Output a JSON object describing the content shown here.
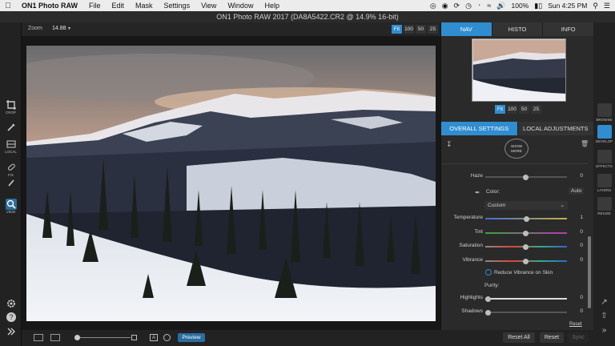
{
  "menubar": {
    "app_name": "ON1 Photo RAW",
    "items": [
      "File",
      "Edit",
      "Mask",
      "Settings",
      "View",
      "Window",
      "Help"
    ],
    "battery": "100%",
    "clock": "Sun 4:25 PM"
  },
  "window": {
    "title": "ON1 Photo RAW 2017 (DA8A5422.CR2 @ 14.9% 16-bit)"
  },
  "canvas": {
    "zoom_label": "Zoom",
    "zoom_value": "14.88",
    "zoom_buttons": [
      "Fit",
      "100",
      "50",
      "25"
    ]
  },
  "left_tools": {
    "crop": "CROP",
    "local": "LOCAL",
    "fix": "FIX",
    "view": "VIEW"
  },
  "panel": {
    "tabs": [
      "NAV",
      "HISTO",
      "INFO"
    ],
    "nav_zoom": [
      "Fit",
      "100",
      "50",
      "25"
    ],
    "settings_tabs": [
      "OVERALL SETTINGS",
      "LOCAL ADJUSTMENTS"
    ],
    "show_more": "SHOW MORE",
    "haze": {
      "label": "Haze",
      "value": "0"
    },
    "color_label": "Color:",
    "auto_label": "Auto",
    "preset": "Custom",
    "temperature": {
      "label": "Temperature",
      "value": "1"
    },
    "tint": {
      "label": "Tint",
      "value": "0"
    },
    "saturation": {
      "label": "Saturation",
      "value": "0"
    },
    "vibrance": {
      "label": "Vibrance",
      "value": "0"
    },
    "reduce_vibrance": "Reduce Vibrance on Skin",
    "purity_label": "Purity:",
    "highlights": {
      "label": "Highlights",
      "value": "0"
    },
    "shadows": {
      "label": "Shadows",
      "value": "0"
    },
    "reset_link": "Reset"
  },
  "right_strip": {
    "browse": "BROWSE",
    "develop": "DEVELOP",
    "effects": "EFFECTS",
    "layers": "LAYERS",
    "resize": "RESIZE"
  },
  "bottom": {
    "preview": "Preview",
    "reset_all": "Reset All",
    "reset": "Reset",
    "sync": "Sync"
  },
  "colors": {
    "accent": "#2f8dd0"
  }
}
